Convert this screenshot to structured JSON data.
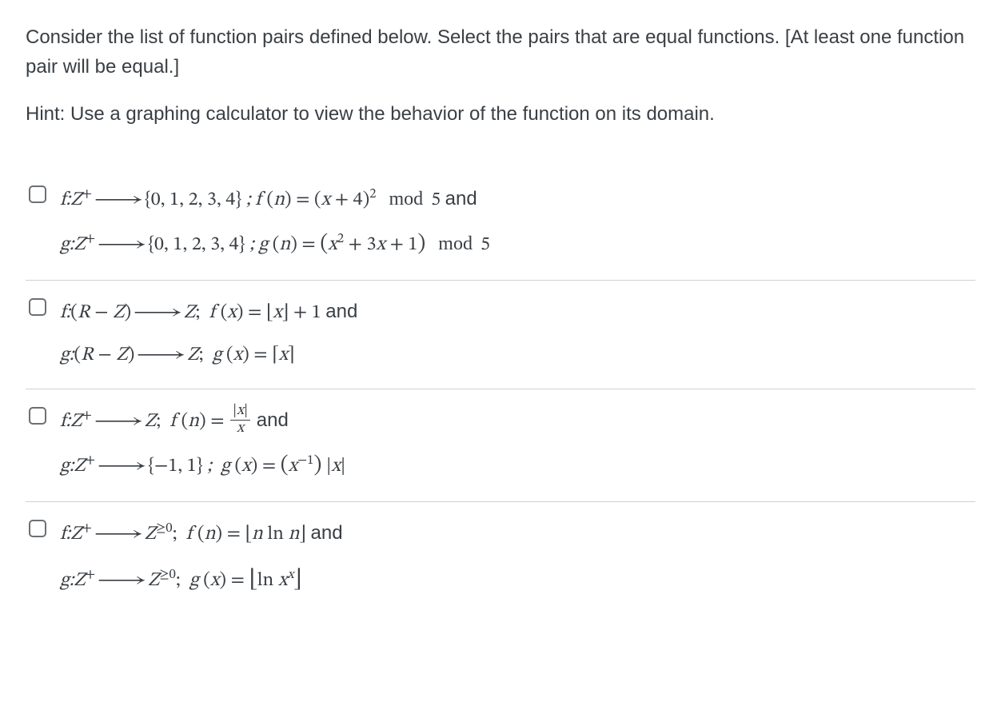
{
  "prompt_text": "Consider the list of function pairs defined below.  Select the pairs that are equal functions.  [At least one function pair will be equal.]",
  "hint_text": "Hint: Use a graphing calculator to view the behavior of the function on its domain.",
  "options": {
    "opt1": {
      "f_html": "f:Z<span class='plus-sup'>+</span> <span class='arrow'>⟶</span> <span class='rm'>{0, 1, 2, 3, 4}</span> ; f <span class='rm'>(</span>n<span class='rm'>)</span> <span class='rm'>=</span> <span class='rm'>(</span>x <span class='rm'>+ 4)</span><sup>2</sup><span class='modw'>mod</span><span class='rm'>5</span> <span class='word'>and</span>",
      "g_html": "g:Z<span class='plus-sup'>+</span> <span class='arrow'>⟶</span> <span class='rm'>{0, 1, 2, 3, 4}</span> ; g <span class='rm'>(</span>n<span class='rm'>)</span> <span class='rm'>=</span> <span class='big1'>(</span>x<sup>2</sup> <span class='rm'>+ 3</span>x <span class='rm'>+ 1</span><span class='big1'>)</span><span class='modw'>mod</span><span class='rm'>5</span>"
    },
    "opt2": {
      "f_html": "f:<span class='rm'>(</span>R <span class='rm'>−</span> Z<span class='rm'>)</span> <span class='arrow'>⟶</span> Z<span class='rm'>;</span>&nbsp; f <span class='rm'>(</span>x<span class='rm'>)</span> <span class='rm'>=</span> <span class='rm'>⌊</span>x<span class='rm'>⌋ + 1</span> <span class='word'>and</span>",
      "g_html": "g:<span class='rm'>(</span>R <span class='rm'>−</span> Z<span class='rm'>)</span> <span class='arrow'>⟶</span> Z<span class='rm'>;</span>&nbsp; g <span class='rm'>(</span>x<span class='rm'>)</span> <span class='rm'>=</span> <span class='rm'>⌈</span>x<span class='rm'>⌉</span>"
    },
    "opt3": {
      "f_html": "f:Z<span class='plus-sup'>+</span> <span class='arrow'>⟶</span> Z<span class='rm'>;</span>&nbsp; f <span class='rm'>(</span>n<span class='rm'>)</span> <span class='rm'>=</span> <span class='frac'><span class='num'>|<i>x</i>|</span><span class='den'><i>x</i></span></span> <span class='word'>and</span>",
      "g_html": "g:Z<span class='plus-sup'>+</span> <span class='arrow'>⟶</span> <span class='rm'>{−1, 1}</span> ;&nbsp; g <span class='rm'>(</span>x<span class='rm'>)</span> <span class='rm'>=</span> <span class='big1'>(</span>x<sup>−1</sup><span class='big1'>)</span> <span class='rm'>|</span>x<span class='rm'>|</span>"
    },
    "opt4": {
      "f_html": "f:Z<span class='plus-sup'>+</span> <span class='arrow'>⟶</span> Z<sup>≥0</sup><span class='rm'>;</span>&nbsp; f <span class='rm'>(</span>n<span class='rm'>)</span> <span class='rm'>=</span> <span class='rm'>⌊</span>n&nbsp;<span class='rm'>ln</span> n<span class='rm'>⌋</span> <span class='word'>and</span>",
      "g_html": "g:Z<span class='plus-sup'>+</span> <span class='arrow'>⟶</span> Z<sup>≥0</sup><span class='rm'>;</span>&nbsp; g <span class='rm'>(</span>x<span class='rm'>)</span> <span class='rm'>=</span> <span class='big2'>⌊</span><span class='rm'>ln</span> x<sup class='it'>x</sup><span class='big2'>⌋</span>"
    }
  }
}
